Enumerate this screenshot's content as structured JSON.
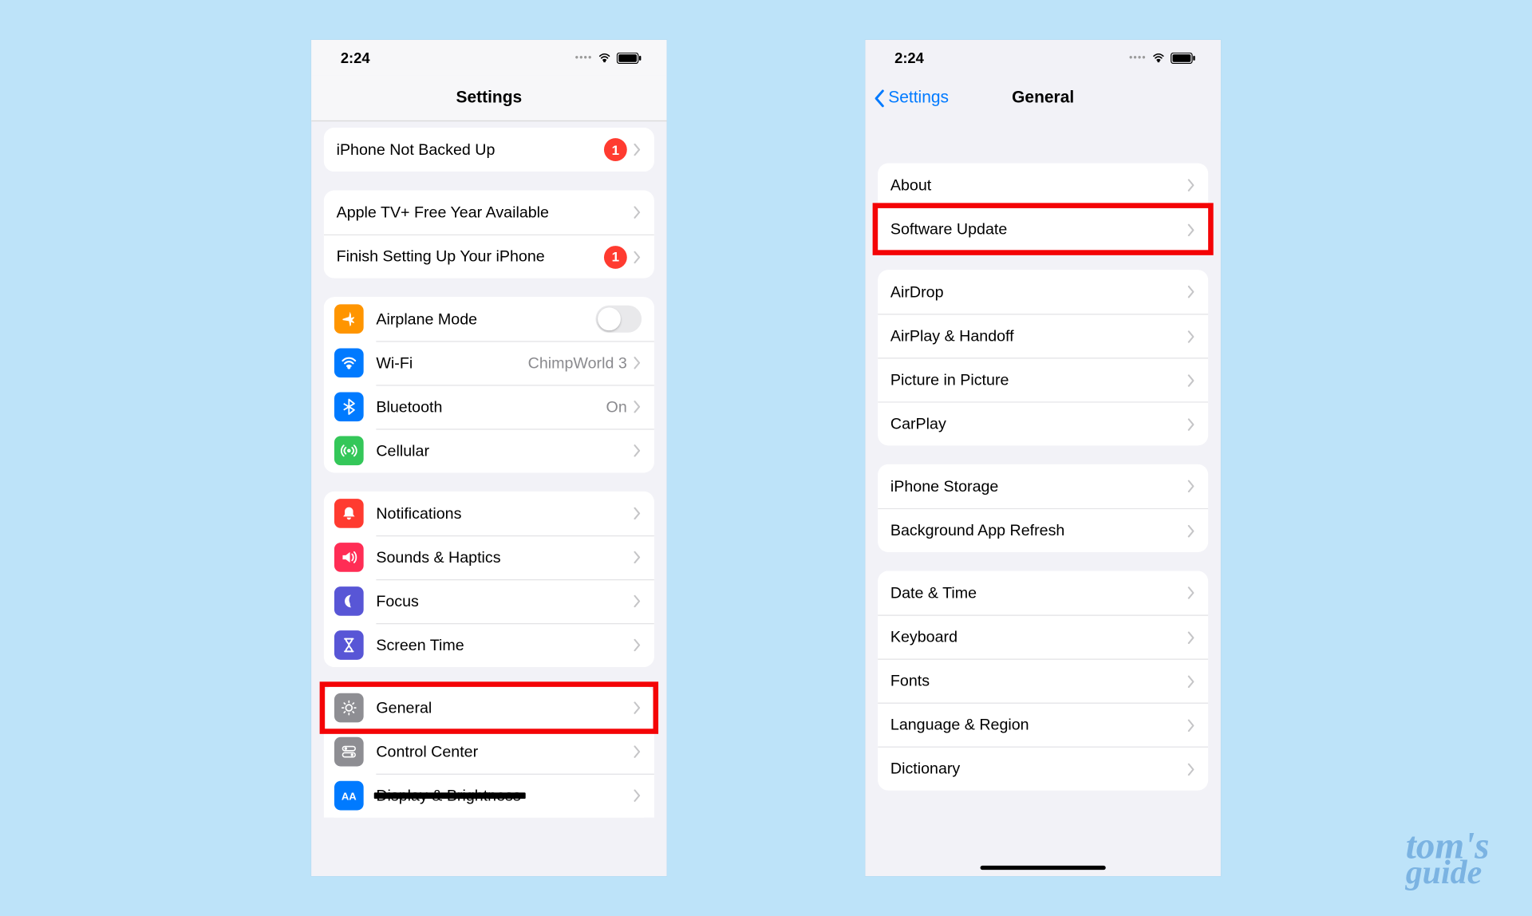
{
  "statusbar": {
    "time": "2:24"
  },
  "left": {
    "title": "Settings",
    "rows_backup": {
      "label": "iPhone Not Backed Up",
      "badge": "1"
    },
    "rows_promo": [
      {
        "label": "Apple TV+ Free Year Available"
      },
      {
        "label": "Finish Setting Up Your iPhone",
        "badge": "1"
      }
    ],
    "rows_conn": [
      {
        "icon": "airplane",
        "color": "#ff9500",
        "label": "Airplane Mode",
        "toggle": true
      },
      {
        "icon": "wifi",
        "color": "#007aff",
        "label": "Wi-Fi",
        "value": "ChimpWorld 3"
      },
      {
        "icon": "bluetooth",
        "color": "#007aff",
        "label": "Bluetooth",
        "value": "On"
      },
      {
        "icon": "cellular",
        "color": "#34c759",
        "label": "Cellular"
      }
    ],
    "rows_notif": [
      {
        "icon": "bell",
        "color": "#ff3b30",
        "label": "Notifications"
      },
      {
        "icon": "speaker",
        "color": "#ff2d55",
        "label": "Sounds & Haptics"
      },
      {
        "icon": "moon",
        "color": "#5856d6",
        "label": "Focus"
      },
      {
        "icon": "hourglass",
        "color": "#5856d6",
        "label": "Screen Time"
      }
    ],
    "rows_sys": [
      {
        "icon": "gear",
        "color": "#8e8e93",
        "label": "General"
      },
      {
        "icon": "switches",
        "color": "#8e8e93",
        "label": "Control Center"
      },
      {
        "icon": "aa",
        "color": "#007aff",
        "label": "Display & Brightness"
      }
    ]
  },
  "right": {
    "back": "Settings",
    "title": "General",
    "g1": [
      {
        "label": "About"
      },
      {
        "label": "Software Update"
      }
    ],
    "g2": [
      {
        "label": "AirDrop"
      },
      {
        "label": "AirPlay & Handoff"
      },
      {
        "label": "Picture in Picture"
      },
      {
        "label": "CarPlay"
      }
    ],
    "g3": [
      {
        "label": "iPhone Storage"
      },
      {
        "label": "Background App Refresh"
      }
    ],
    "g4": [
      {
        "label": "Date & Time"
      },
      {
        "label": "Keyboard"
      },
      {
        "label": "Fonts"
      },
      {
        "label": "Language & Region"
      },
      {
        "label": "Dictionary"
      }
    ]
  },
  "watermark": {
    "line1": "tom's",
    "line2": "guide"
  }
}
